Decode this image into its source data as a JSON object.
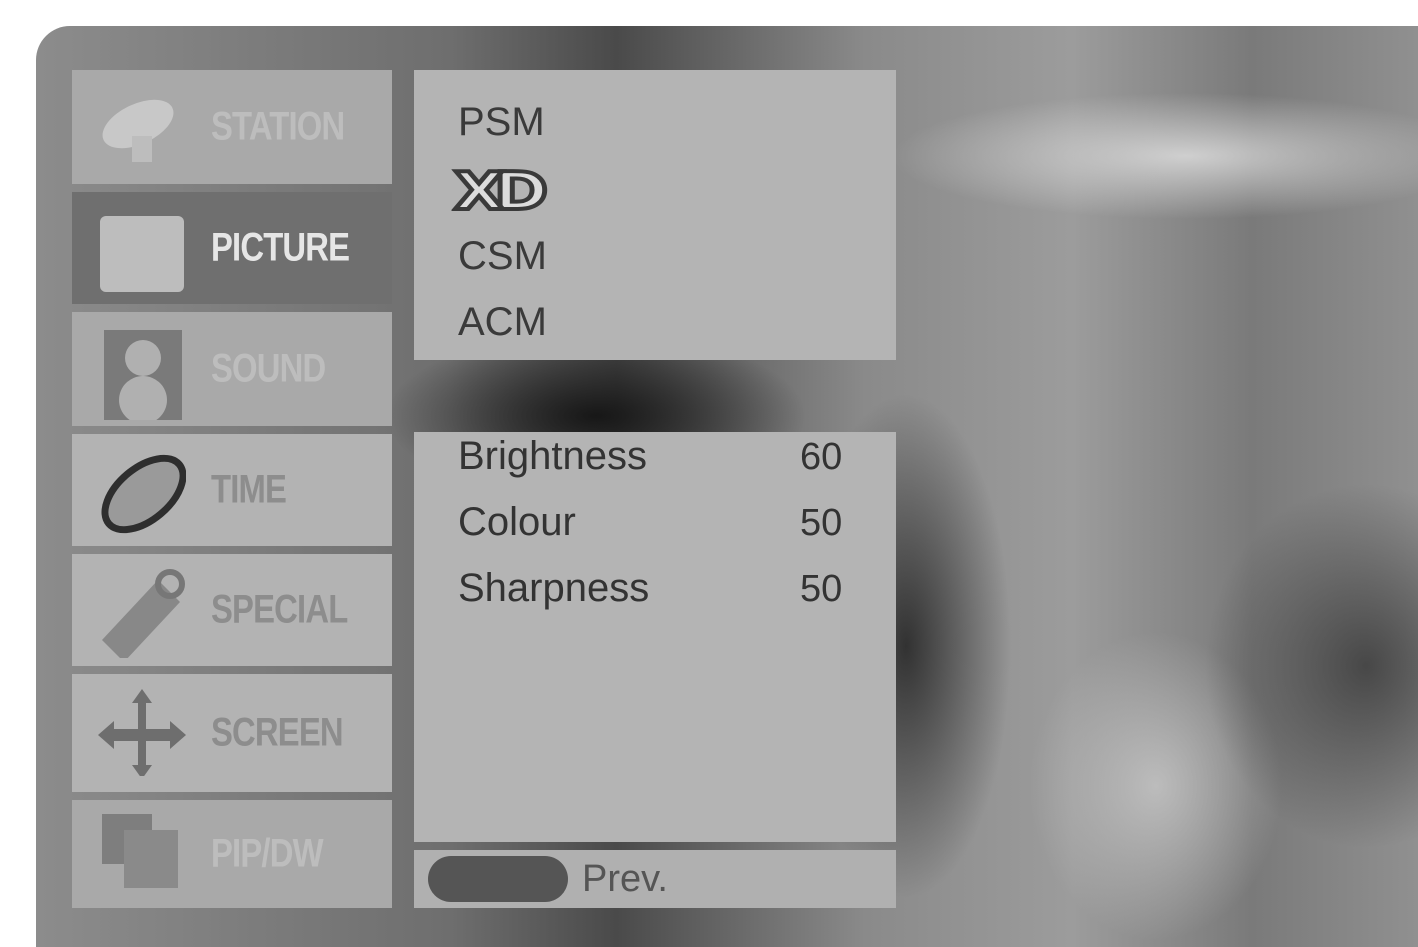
{
  "sidebar": {
    "items": [
      {
        "label": "STATION",
        "icon": "satellite-dish-icon",
        "state": "disabled"
      },
      {
        "label": "PICTURE",
        "icon": "picture-icon",
        "state": "selected"
      },
      {
        "label": "SOUND",
        "icon": "speaker-icon",
        "state": "disabled"
      },
      {
        "label": "TIME",
        "icon": "clock-icon",
        "state": "normal"
      },
      {
        "label": "SPECIAL",
        "icon": "tag-icon",
        "state": "normal"
      },
      {
        "label": "SCREEN",
        "icon": "move-arrows-icon",
        "state": "normal"
      },
      {
        "label": "PIP/DW",
        "icon": "pip-windows-icon",
        "state": "disabled"
      }
    ]
  },
  "picture_menu": {
    "options": [
      "PSM",
      "XD",
      "CSM",
      "ACM"
    ],
    "settings": [
      {
        "label": "Brightness",
        "value": "60"
      },
      {
        "label": "Colour",
        "value": "50"
      },
      {
        "label": "Sharpness",
        "value": "50"
      }
    ]
  },
  "footer": {
    "prev_label": "Prev."
  }
}
